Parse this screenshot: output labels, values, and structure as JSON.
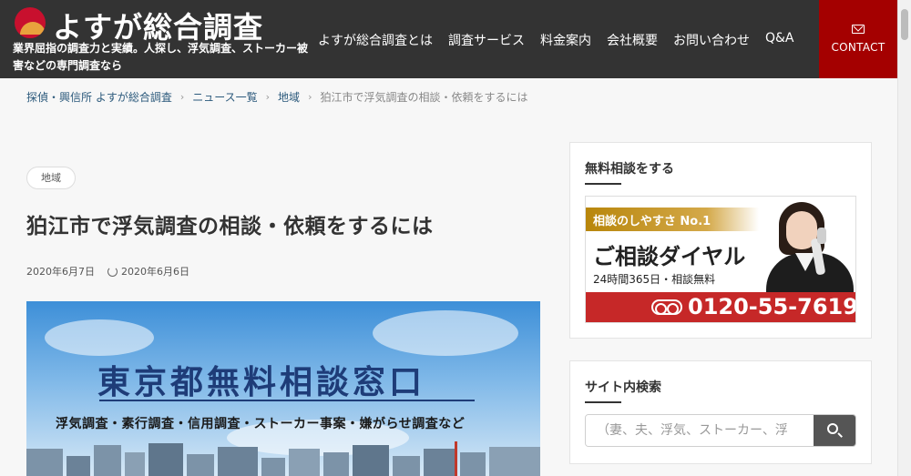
{
  "header": {
    "logo_text": "よすが総合調査",
    "tagline": "業界屈指の調査力と実績。人探し、浮気調査、ストーカー被害などの専門調査なら",
    "nav": [
      "よすが総合調査とは",
      "調査サービス",
      "料金案内",
      "会社概要",
      "お問い合わせ",
      "Q&A"
    ],
    "contact_label": "CONTACT",
    "contact_icon": "mail-icon",
    "colors": {
      "header_bg": "#333333",
      "contact_bg": "#a40000",
      "logo_red": "#c8102e",
      "logo_gold": "#e8a33d"
    }
  },
  "breadcrumb": {
    "items": [
      "探偵・興信所 よすが総合調査",
      "ニュース一覧",
      "地域"
    ],
    "current": "狛江市で浮気調査の相談・依頼をするには"
  },
  "post": {
    "category": "地域",
    "title": "狛江市で浮気調査の相談・依頼をするには",
    "published": "2020年6月7日",
    "updated": "2020年6月6日",
    "hero": {
      "title": "東京都無料相談窓口",
      "subtitle": "浮気調査・素行調査・信用調査・ストーカー事案・嫌がらせ調査など"
    }
  },
  "sidebar": {
    "consult_widget": {
      "title": "無料相談をする",
      "banner_ribbon": "相談のしやすさ No.1",
      "banner_title": "ご相談ダイヤル",
      "banner_sub": "24時間365日・相談無料",
      "phone": "0120-55-7619",
      "colors": {
        "ribbon": "#d4a94a",
        "phone_bar": "#c62828"
      }
    },
    "search_widget": {
      "title": "サイト内検索",
      "placeholder": "（妻、夫、浮気、ストーカー、浮",
      "value": ""
    }
  }
}
